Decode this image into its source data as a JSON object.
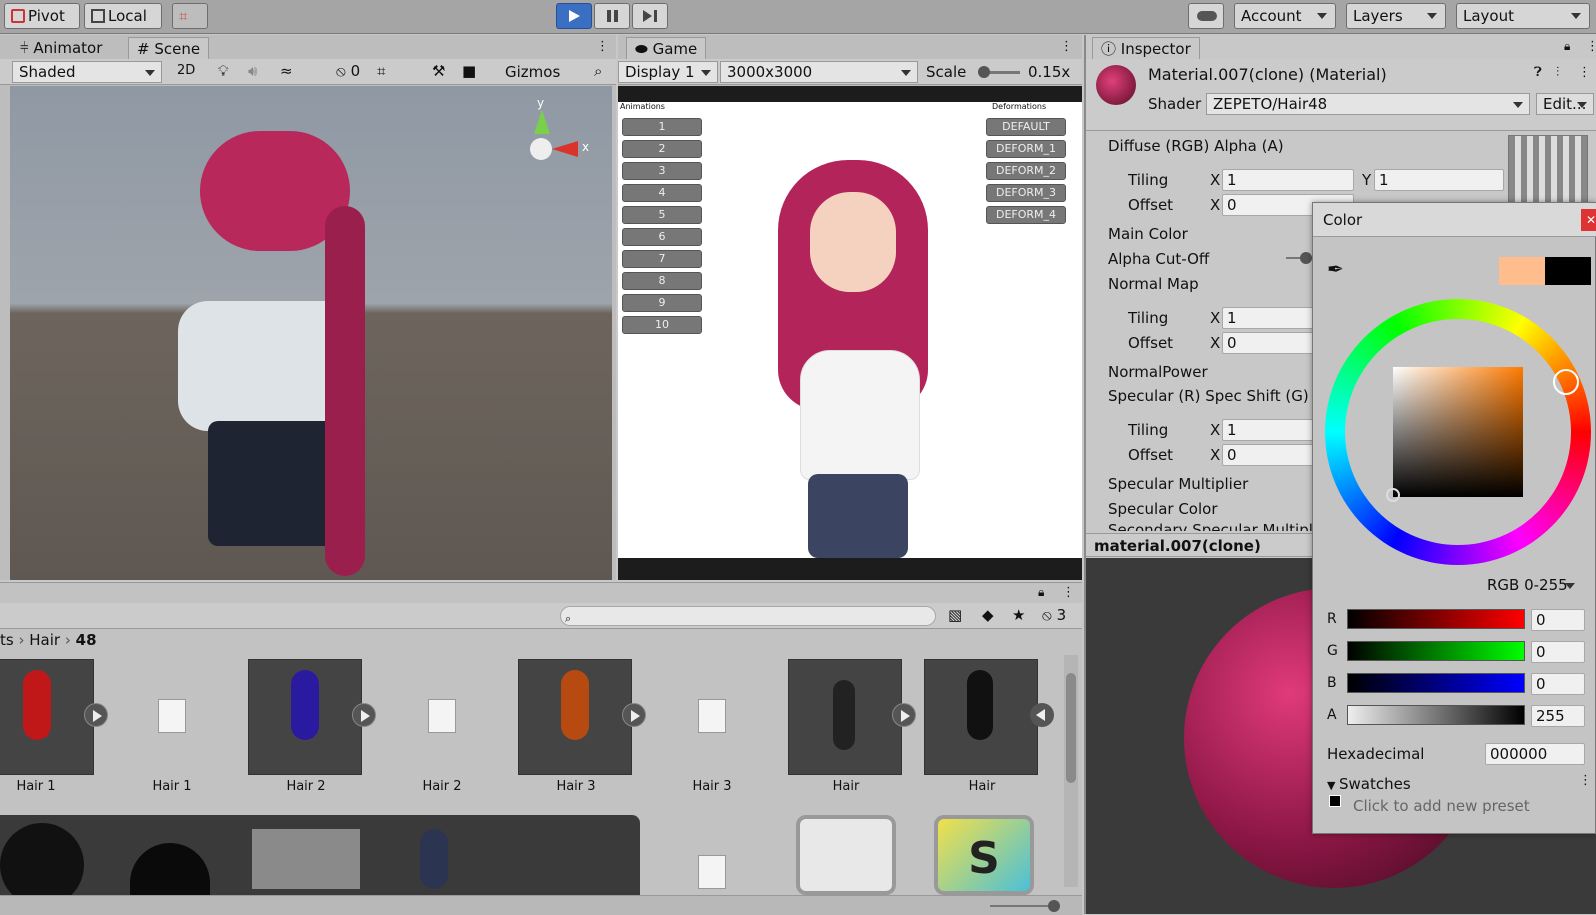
{
  "toolbar": {
    "pivot": "Pivot",
    "local": "Local",
    "account": "Account",
    "layers": "Layers",
    "layout": "Layout"
  },
  "scene_panel": {
    "tab_animator": "Animator",
    "tab_scene": "Scene",
    "shading": "Shaded",
    "mode_2d": "2D",
    "hidden_count": "0",
    "gizmos": "Gizmos",
    "axis_y": "y",
    "axis_x": "x"
  },
  "game_panel": {
    "tab": "Game",
    "display": "Display 1",
    "resolution": "3000x3000",
    "scale_label": "Scale",
    "scale_value": "0.15x",
    "animations_header": "Animations",
    "deformations_header": "Deformations",
    "animation_buttons": [
      "1",
      "2",
      "3",
      "4",
      "5",
      "6",
      "7",
      "8",
      "9",
      "10"
    ],
    "deform_buttons": [
      "DEFAULT",
      "DEFORM_1",
      "DEFORM_2",
      "DEFORM_3",
      "DEFORM_4"
    ]
  },
  "project_panel": {
    "breadcrumb": [
      "ts",
      "Hair",
      "48"
    ],
    "hidden_count": "3",
    "assets_row1": [
      "Hair 1",
      "Hair 1",
      "Hair 2",
      "Hair 2",
      "Hair 3",
      "Hair 3",
      "Hair",
      "Hair"
    ]
  },
  "inspector": {
    "tab": "Inspector",
    "title": "Material.007(clone) (Material)",
    "shader_label": "Shader",
    "shader_value": "ZEPETO/Hair48",
    "edit_button": "Edit...",
    "diffuse": "Diffuse (RGB) Alpha (A)",
    "tiling": "Tiling",
    "offset": "Offset",
    "x": "X",
    "y": "Y",
    "one": "1",
    "zero": "0",
    "main_color": "Main Color",
    "alpha_cutoff": "Alpha Cut-Off",
    "normal_map": "Normal Map",
    "normal_power": "NormalPower",
    "specular_r": "Specular (R) Spec Shift (G) Sp",
    "specular_multiplier": "Specular Multiplier",
    "specular_color": "Specular Color",
    "secondary_specular": "Secondary Specular Multiplie",
    "preview_title": "material.007(clone)"
  },
  "color_picker": {
    "title": "Color",
    "mode": "RGB 0-255",
    "channels": [
      {
        "name": "R",
        "value": "0"
      },
      {
        "name": "G",
        "value": "0"
      },
      {
        "name": "B",
        "value": "0"
      },
      {
        "name": "A",
        "value": "255"
      }
    ],
    "hex_label": "Hexadecimal",
    "hex_value": "000000",
    "swatches": "Swatches",
    "add_preset": "Click to add new preset",
    "previous_color": "#ffbc8c",
    "current_color": "#000000"
  }
}
